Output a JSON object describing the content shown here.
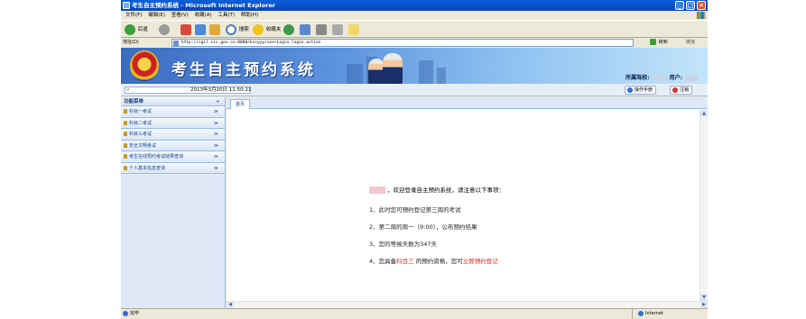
{
  "window": {
    "title": "考生自主预约系统 - Microsoft Internet Explorer",
    "controls": {
      "minimize": "_",
      "maximize": "□",
      "close": "×"
    }
  },
  "menu": [
    "文件(F)",
    "编辑(E)",
    "查看(V)",
    "收藏(A)",
    "工具(T)",
    "帮助(H)"
  ],
  "toolbar": {
    "back": "后退",
    "search": "搜索",
    "favorites": "收藏夹"
  },
  "address": {
    "label": "地址(D)",
    "url": "http://cgsl.sic.gov.cn:8088/kscyyy/userLogin_login.action",
    "go": "转到",
    "links": "链接"
  },
  "banner": {
    "system_title": "考生自主预约系统",
    "school_label": "所属驾校:",
    "user_label": "用户:"
  },
  "strip": {
    "datetime": "2013年3月20日 11:50:21",
    "help_button": "操作手册",
    "logout_button": "注销"
  },
  "sidebar": {
    "title": "功能菜单",
    "collapse": "«",
    "items": [
      {
        "label": "科目一考试"
      },
      {
        "label": "科目二考试"
      },
      {
        "label": "科目三考试"
      },
      {
        "label": "安全文明考试"
      },
      {
        "label": "考生在线预约考试结果查询"
      },
      {
        "label": "个人基本信息查询"
      }
    ],
    "chevron": "≫"
  },
  "main": {
    "tab": "首页",
    "welcome": "，欢迎登录自主预约系统，请注意以下事项：",
    "notice1": "1、此时您可预约登记第三周的考试",
    "notice2": "2、第二周的周一（9:00），公布预约结果",
    "notice3": "3、您的等候天数为347天",
    "notice4_pre": "4、您具备",
    "notice4_subject": "科目三",
    "notice4_mid": " 的预约资格，您可",
    "notice4_link": "立即预约登记"
  },
  "status": {
    "left": "完毕",
    "zone": "Internet"
  },
  "colors": {
    "titlebar": "#0a5fd9",
    "banner_start": "#3a6cc0",
    "banner_end": "#c4e4fa",
    "sidebar_text": "#15428b",
    "accent_red": "#e3241b"
  }
}
